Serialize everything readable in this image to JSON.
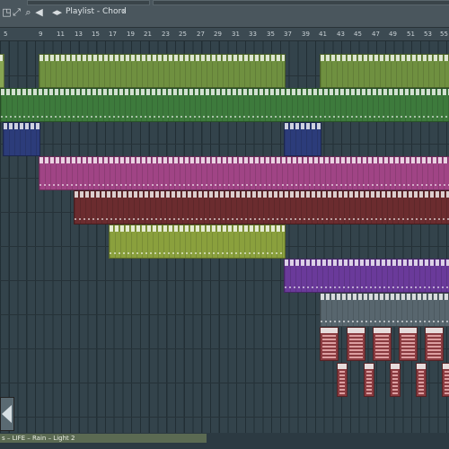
{
  "window": {
    "title": "Playlist - Chord",
    "title_chevron": "›"
  },
  "toolbar": {
    "icons": [
      "hint-icon",
      "snap-icon",
      "select-icon",
      "zoom-icon",
      "speaker-icon",
      "arrows-icon"
    ]
  },
  "ruler": {
    "bars": [
      "5",
      "9",
      "11",
      "13",
      "15",
      "17",
      "19",
      "21",
      "23",
      "25",
      "27",
      "29",
      "31",
      "33",
      "35",
      "37",
      "39",
      "41",
      "43",
      "45",
      "47",
      "49",
      "51",
      "53",
      "55"
    ]
  },
  "colors": {
    "green": "#6f9040",
    "green_light": "#87a552",
    "green_dark": "#3d7a3c",
    "navy": "#2c3c7a",
    "magenta": "#a04485",
    "maroon": "#6b2c2f",
    "olive": "#8aa03d",
    "purple": "#6a3a9a",
    "gray": "#8b98a0",
    "red": "#a7474d"
  },
  "status": {
    "text": "s  –  LIFE  –  Rain  –  Light 2"
  }
}
